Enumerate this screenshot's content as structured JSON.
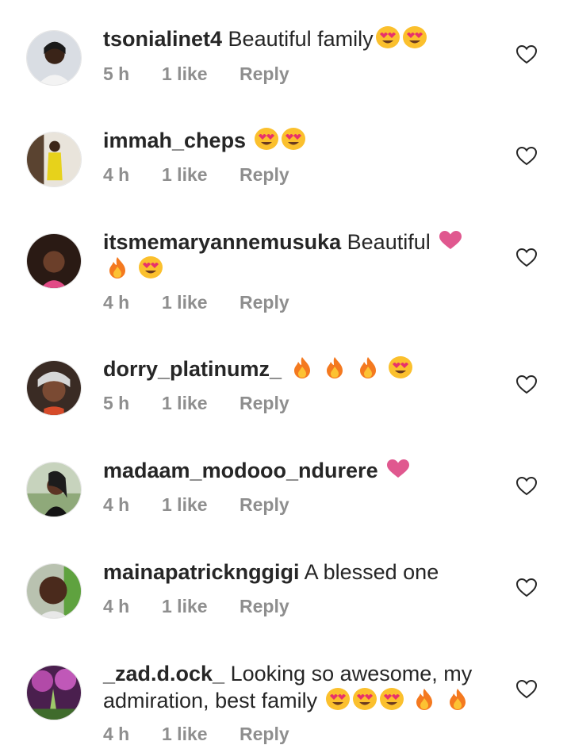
{
  "comments": [
    {
      "username": "tsonialinet4",
      "text": "Beautiful family",
      "emojis": [
        "heart-eyes",
        "heart-eyes"
      ],
      "time": "5 h",
      "likes": "1 like",
      "reply": "Reply"
    },
    {
      "username": "immah_cheps",
      "text": "",
      "emojis": [
        "heart-eyes",
        "heart-eyes"
      ],
      "time": "4 h",
      "likes": "1 like",
      "reply": "Reply"
    },
    {
      "username": "itsmemaryannemusuka",
      "text": "Beautiful",
      "emojis": [
        "pink-heart",
        "fire",
        "heart-eyes"
      ],
      "time": "4 h",
      "likes": "1 like",
      "reply": "Reply"
    },
    {
      "username": "dorry_platinumz_",
      "text": "",
      "emojis": [
        "fire",
        "fire",
        "fire",
        "heart-eyes"
      ],
      "time": "5 h",
      "likes": "1 like",
      "reply": "Reply"
    },
    {
      "username": "madaam_modooo_ndurere",
      "text": "",
      "emojis": [
        "pink-heart"
      ],
      "time": "4 h",
      "likes": "1 like",
      "reply": "Reply"
    },
    {
      "username": "mainapatricknggigi",
      "text": "A blessed one",
      "emojis": [],
      "time": "4 h",
      "likes": "1 like",
      "reply": "Reply"
    },
    {
      "username": "_zad.d.ock_",
      "text": "Looking so awesome, my admiration, best family",
      "emojis": [
        "heart-eyes",
        "heart-eyes",
        "heart-eyes",
        "fire",
        "fire"
      ],
      "time": "4 h",
      "likes": "1 like",
      "reply": "Reply"
    }
  ],
  "colors": {
    "text": "#262626",
    "meta": "#8e8e8e",
    "heart-outline": "#262626",
    "pink-heart": "#e0588f",
    "fire": "#f4791f",
    "emoji-face": "#fbc02d"
  }
}
